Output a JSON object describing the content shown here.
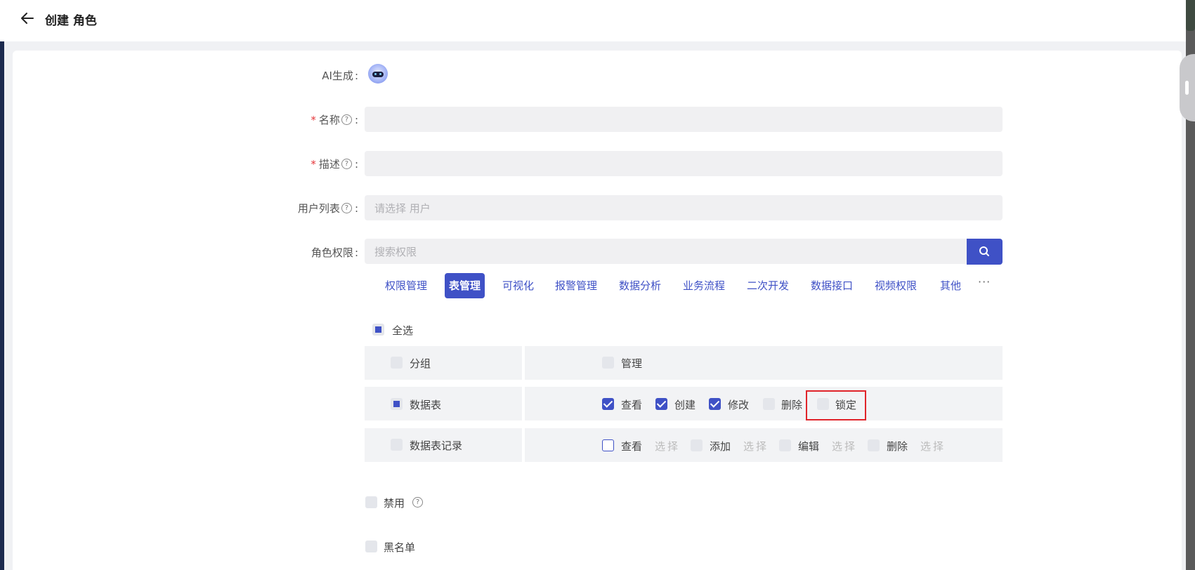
{
  "header": {
    "title": "创建 角色",
    "back_icon": "arrow-left-icon"
  },
  "form": {
    "ai_label": "AI生成",
    "name_label": "名称",
    "desc_label": "描述",
    "users_label": "用户列表",
    "users_placeholder": "请选择 用户",
    "perm_label": "角色权限",
    "perm_placeholder": "搜索权限",
    "required_mark": "*",
    "help_mark": "?",
    "colon": ":"
  },
  "tabs": [
    "权限管理",
    "表管理",
    "可视化",
    "报警管理",
    "数据分析",
    "业务流程",
    "二次开发",
    "数据接口",
    "视频权限",
    "其他"
  ],
  "tab_more": "···",
  "active_tab": "表管理",
  "select_all": "全选",
  "table": {
    "rows": [
      {
        "name": "分组",
        "name_state": "unchecked",
        "perms": [
          {
            "label": "管理",
            "state": "unchecked"
          }
        ]
      },
      {
        "name": "数据表",
        "name_state": "partial",
        "perms": [
          {
            "label": "查看",
            "state": "checked"
          },
          {
            "label": "创建",
            "state": "checked"
          },
          {
            "label": "修改",
            "state": "checked"
          },
          {
            "label": "删除",
            "state": "unchecked"
          },
          {
            "label": "锁定",
            "state": "unchecked"
          }
        ]
      },
      {
        "name": "数据表记录",
        "name_state": "unchecked",
        "perms": [
          {
            "label": "查看",
            "state": "outline",
            "select": "选择"
          },
          {
            "label": "添加",
            "state": "unchecked",
            "select": "选择"
          },
          {
            "label": "编辑",
            "state": "unchecked",
            "select": "选择"
          },
          {
            "label": "删除",
            "state": "unchecked",
            "select": "选择"
          }
        ]
      }
    ]
  },
  "disable_label": "禁用",
  "blacklist_label": "黑名单",
  "colors": {
    "accent": "#3f51c6",
    "highlight": "#e0242a"
  }
}
